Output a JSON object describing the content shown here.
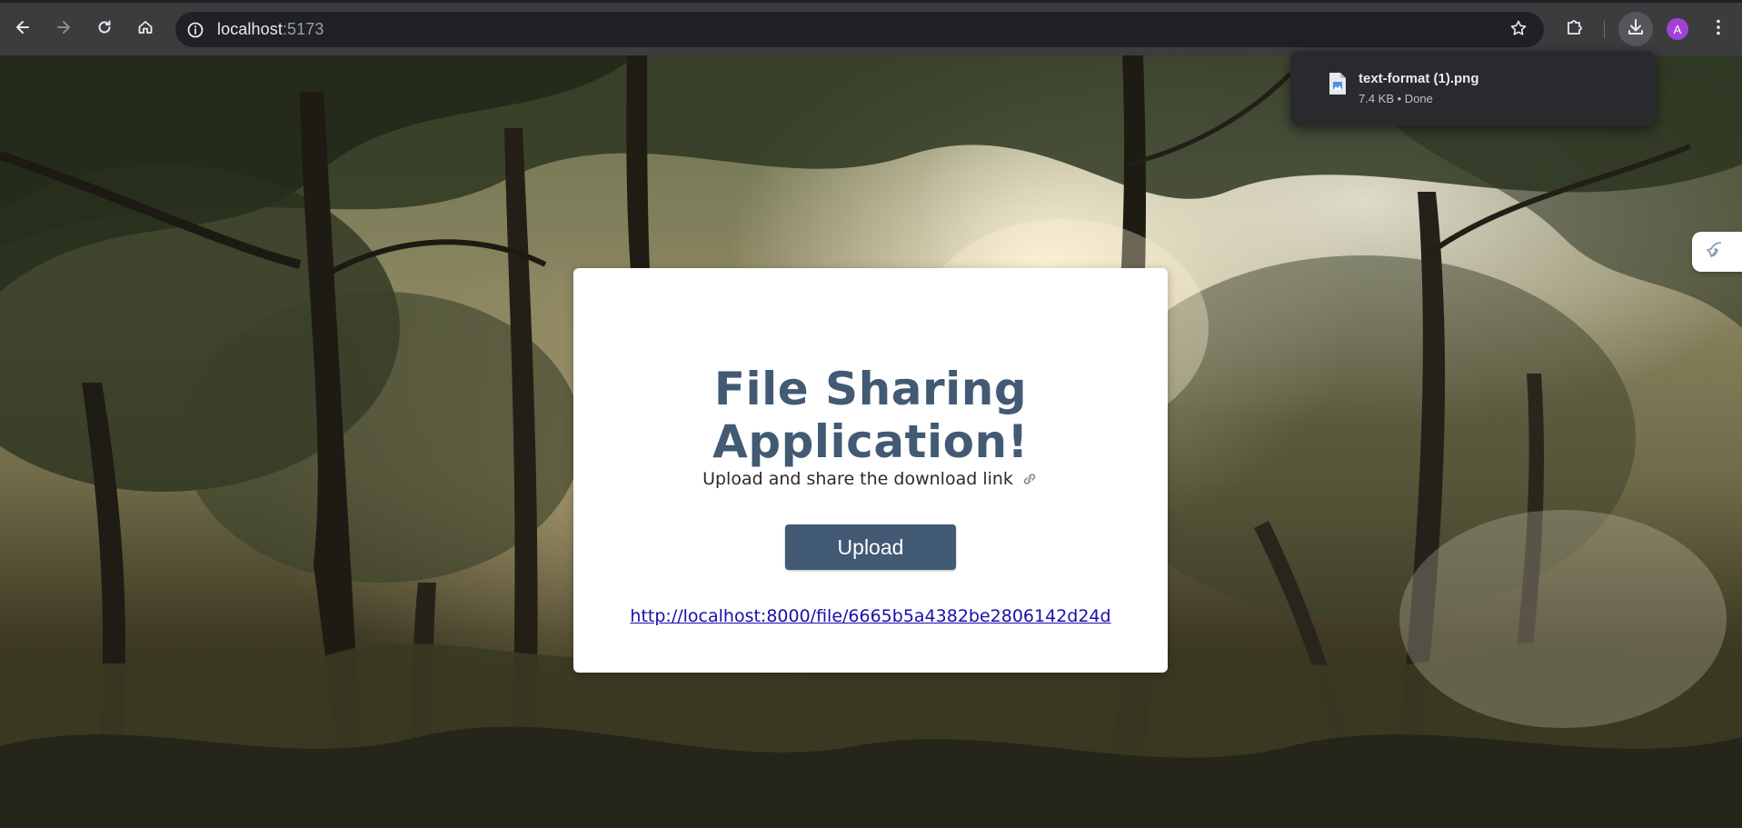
{
  "browser": {
    "url_host": "localhost",
    "url_port": ":5173",
    "avatar_letter": "A",
    "accent_avatar_color": "#a142d4",
    "icons": {
      "back": "arrow-left-icon",
      "forward": "arrow-right-icon",
      "reload": "reload-icon",
      "home": "home-icon",
      "site_info": "info-icon",
      "bookmark": "star-icon",
      "extensions": "puzzle-icon",
      "downloads": "download-icon",
      "menu": "kebab-menu-icon"
    }
  },
  "downloads_bubble": {
    "file_name": "text-format (1).png",
    "file_meta": "7.4 KB • Done",
    "file_icon": "image-file-icon"
  },
  "card": {
    "title": "File Sharing Application!",
    "subtitle": "Upload and share the download link",
    "subtitle_icon": "link-icon",
    "upload_label": "Upload",
    "share_link": "http://localhost:8000/file/6665b5a4382be2806142d24d",
    "primary_color": "#425a73"
  },
  "side_widget": {
    "icon": "rocket-icon"
  }
}
